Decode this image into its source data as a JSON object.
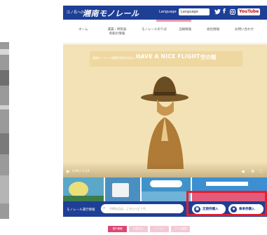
{
  "header": {
    "small_brand": "江ノ島への近道",
    "logo": "湘南モノレール",
    "lang_label": "Language",
    "lang_select": "Language",
    "sns": [
      "twitter-icon",
      "facebook-icon",
      "instagram-icon"
    ],
    "youtube": "YouTube"
  },
  "nav": {
    "items": [
      "ホーム",
      "運賃・時刻表\n各駅の情報",
      "モノレールのりば",
      "沿線情報",
      "会社情報",
      "お問い合わせ"
    ]
  },
  "hero": {
    "banner_small": "湘南モノレール開業50周年記念ムービー",
    "title": "HAVE A NICE FLIGHT",
    "subtitle": "空の朝",
    "time": "0:00 / 1:13"
  },
  "search": {
    "label": "モノレール運行情報",
    "placeholder": "不明な点は、こちらへどうぞ。",
    "btn1": "定期券購入",
    "btn2": "乗車券購入"
  },
  "pager": {
    "tabs": [
      "運行情報",
      "お知らせ",
      "イベント",
      "プレス発表"
    ]
  },
  "colors": {
    "brand_blue": "#1e3f95",
    "highlight_red": "#ea1d2b",
    "hero_bg": "#f3e2b6"
  }
}
